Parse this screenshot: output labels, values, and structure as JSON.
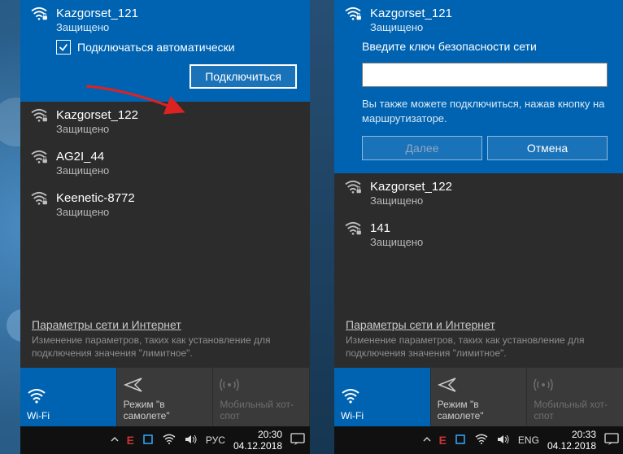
{
  "left": {
    "selected": {
      "name": "Kazgorset_121",
      "status": "Защищено",
      "auto_connect_label": "Подключаться автоматически",
      "connect_button": "Подключиться"
    },
    "networks": [
      {
        "name": "Kazgorset_122",
        "status": "Защищено"
      },
      {
        "name": "AG2I_44",
        "status": "Защищено"
      },
      {
        "name": "Keenetic-8772",
        "status": "Защищено"
      }
    ],
    "settings": {
      "link": "Параметры сети и Интернет",
      "desc": "Изменение параметров, таких как установление для подключения значения \"лимитное\"."
    },
    "tiles": {
      "wifi": "Wi-Fi",
      "airplane": "Режим \"в самолете\"",
      "hotspot": "Мобильный хот-спот"
    },
    "taskbar": {
      "lang": "РУС",
      "time": "20:30",
      "date": "04.12.2018"
    }
  },
  "right": {
    "selected": {
      "name": "Kazgorset_121",
      "status": "Защищено",
      "prompt": "Введите ключ безопасности сети",
      "hint": "Вы также можете подключиться, нажав кнопку на маршрутизаторе.",
      "next_button": "Далее",
      "cancel_button": "Отмена"
    },
    "networks": [
      {
        "name": "Kazgorset_122",
        "status": "Защищено"
      },
      {
        "name": "141",
        "status": "Защищено"
      }
    ],
    "settings": {
      "link": "Параметры сети и Интернет",
      "desc": "Изменение параметров, таких как установление для подключения значения \"лимитное\"."
    },
    "tiles": {
      "wifi": "Wi-Fi",
      "airplane": "Режим \"в самолете\"",
      "hotspot": "Мобильный хот-спот"
    },
    "taskbar": {
      "lang": "ENG",
      "time": "20:33",
      "date": "04.12.2018"
    }
  }
}
